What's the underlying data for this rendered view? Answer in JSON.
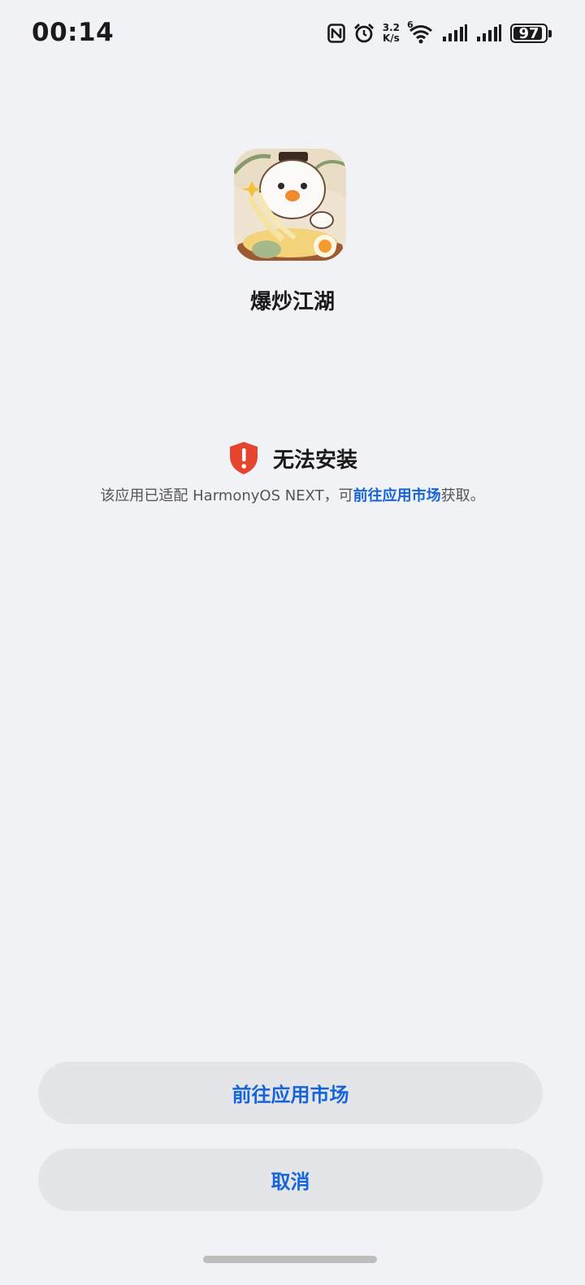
{
  "status_bar": {
    "time": "00:14",
    "speed_value": "3.2",
    "speed_unit": "K/s",
    "wifi_badge": "6",
    "battery": "97",
    "battery_level": 0.97,
    "icons": [
      "nfc-icon",
      "alarm-icon",
      "wifi-icon",
      "signal-icon",
      "signal-icon",
      "battery-icon"
    ]
  },
  "app": {
    "name": "爆炒江湖",
    "icon": "app-icon"
  },
  "warning": {
    "title": "无法安装",
    "icon": "shield-alert-icon",
    "accent_color": "#e5452f",
    "desc_prefix": "该应用已适配 HarmonyOS NEXT，可",
    "desc_link": "前往应用市场",
    "desc_suffix": "获取。"
  },
  "buttons": {
    "primary": "前往应用市场",
    "cancel": "取消"
  },
  "colors": {
    "background": "#f1f2f5",
    "link": "#1664d9",
    "button_bg": "#e4e5e8"
  }
}
